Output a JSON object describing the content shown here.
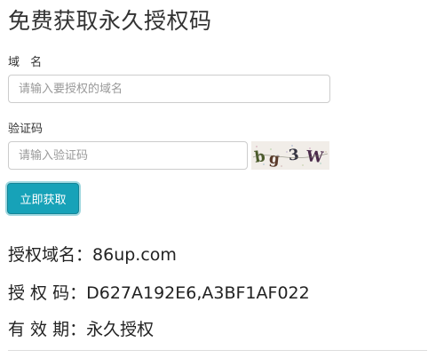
{
  "page": {
    "title": "免费获取永久授权码"
  },
  "form": {
    "domain_label": "域 名",
    "domain_placeholder": "请输入要授权的域名",
    "domain_value": "",
    "captcha_label": "验证码",
    "captcha_placeholder": "请输入验证码",
    "captcha_value": "",
    "captcha_image_text": "b g 3 W",
    "submit_label": "立即获取"
  },
  "result": {
    "domain_key": "授权域名：",
    "domain_value": "86up.com",
    "code_key": "授 权 码：",
    "code_value": "D627A192E6,A3BF1AF022",
    "validity_key": "有 效 期：",
    "validity_value": "永久授权"
  },
  "colors": {
    "accent": "#17a2b8",
    "text": "#333333",
    "border": "#cccccc"
  }
}
